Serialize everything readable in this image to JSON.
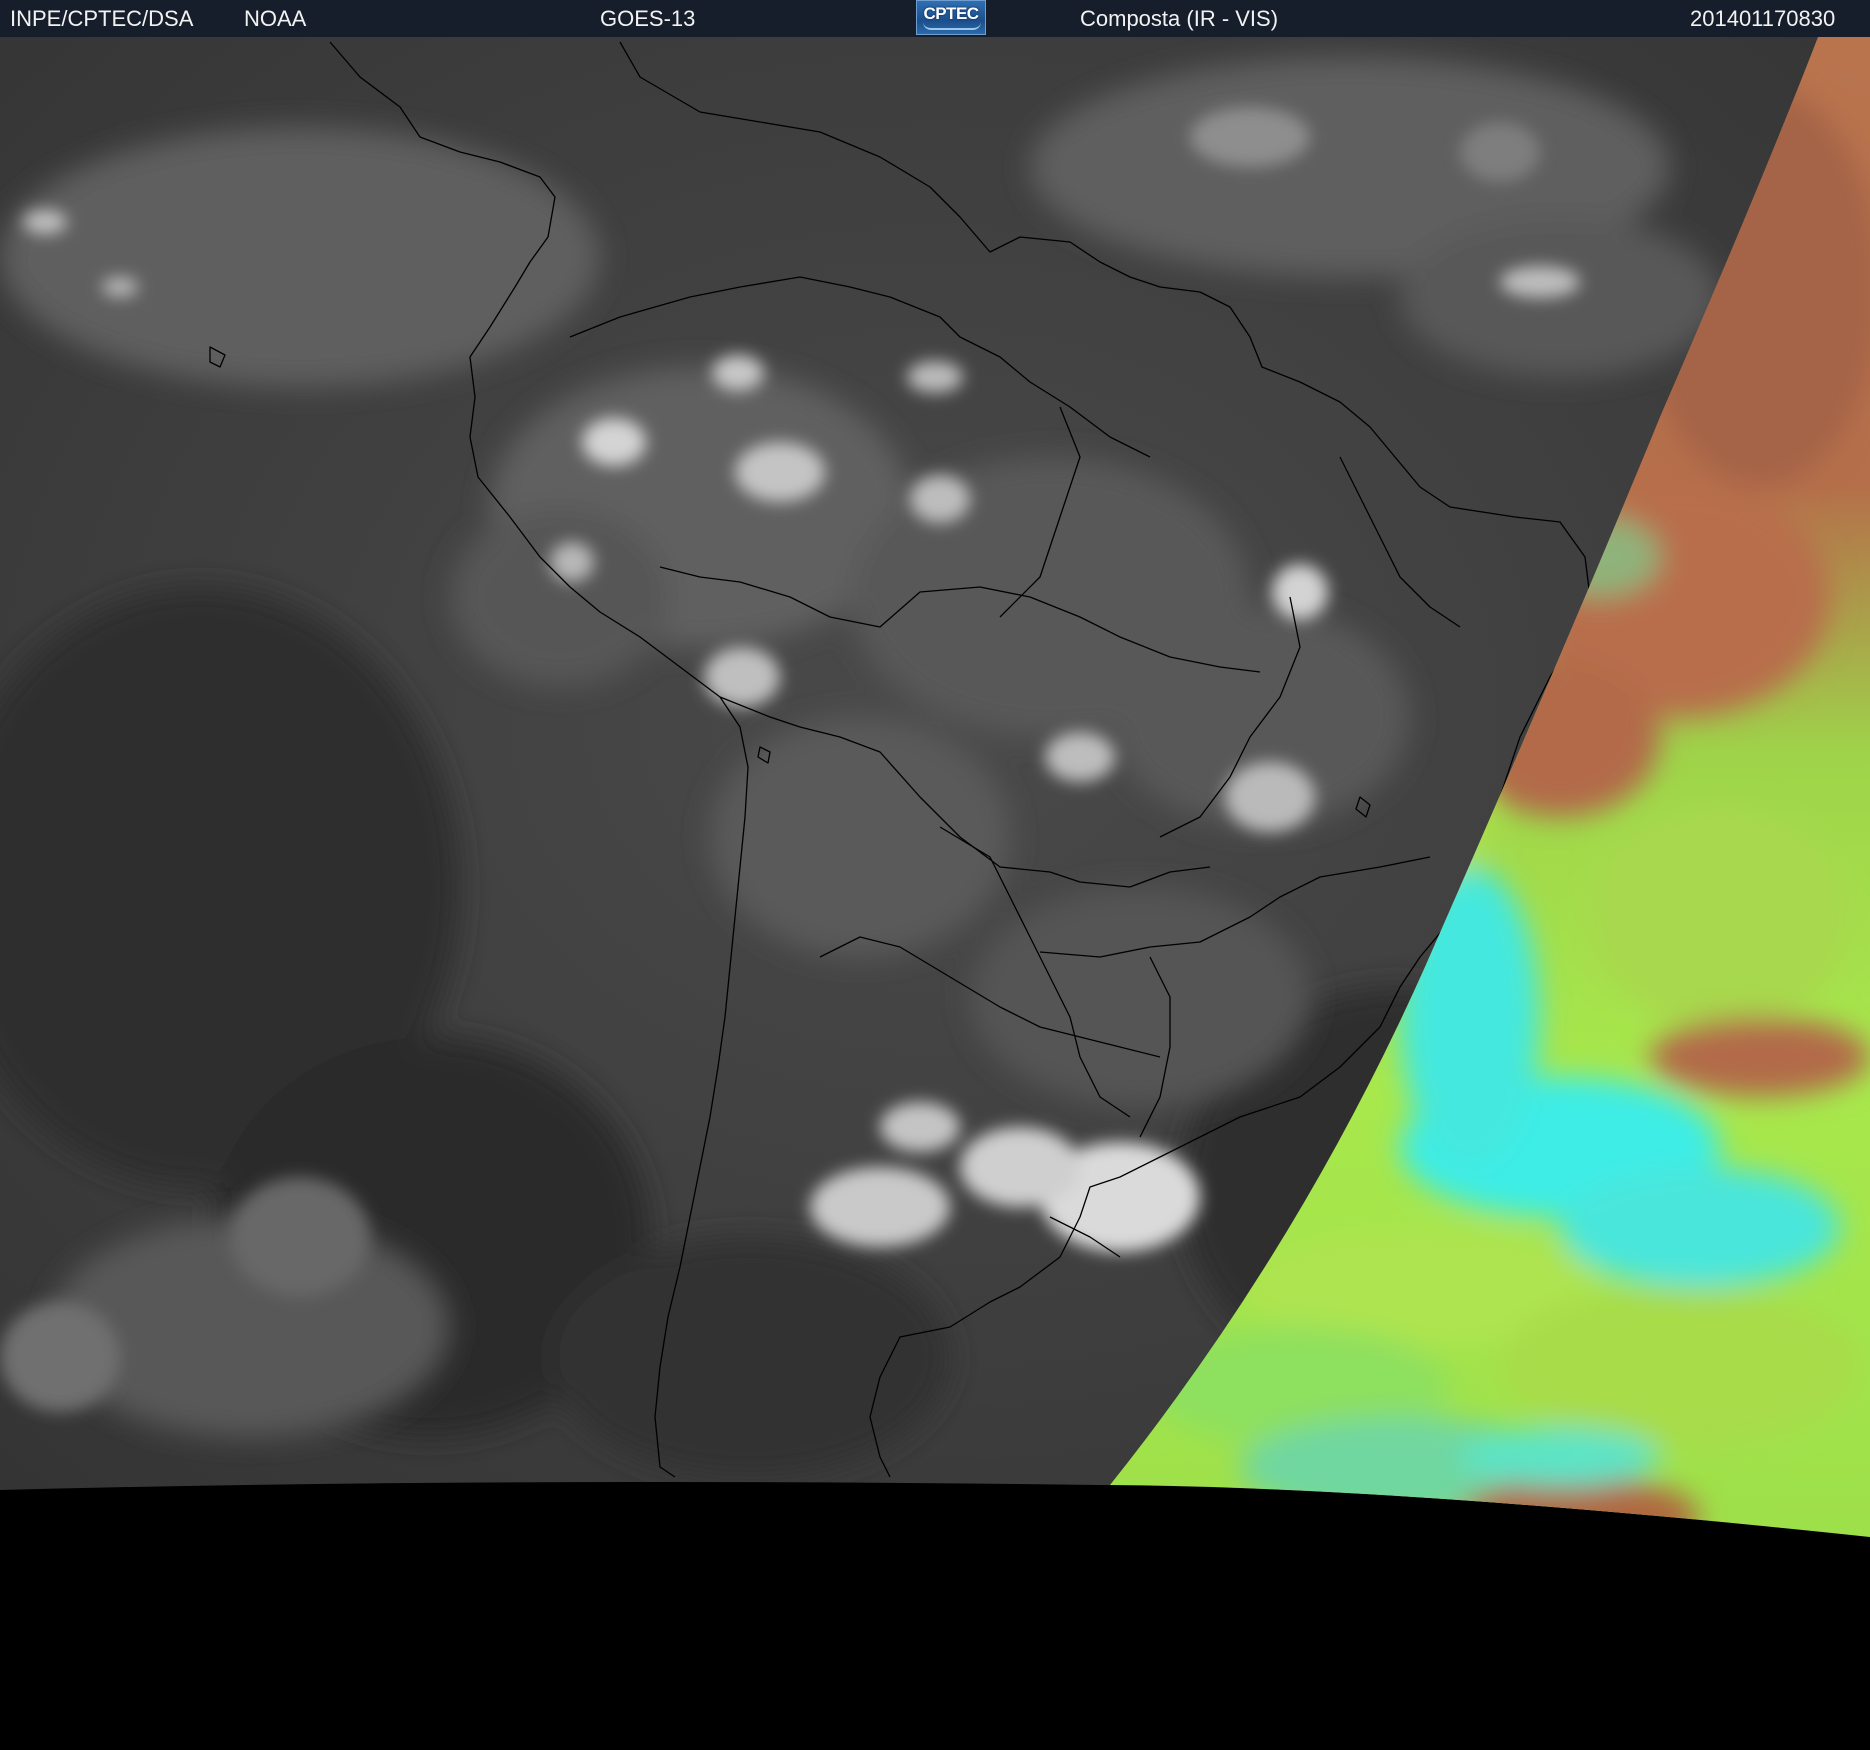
{
  "header": {
    "source": "INPE/CPTEC/DSA",
    "agency": "NOAA",
    "satellite": "GOES-13",
    "logo_text": "CPTEC",
    "product": "Composta (IR - VIS)",
    "timestamp": "201401170830"
  },
  "map": {
    "ir_region": "infrared grayscale",
    "vis_region": "visible false-color",
    "space_color": "#000000",
    "vis_colors": [
      "#b8704a",
      "#a5e84a",
      "#3cf0e6",
      "#6fd68a"
    ]
  }
}
